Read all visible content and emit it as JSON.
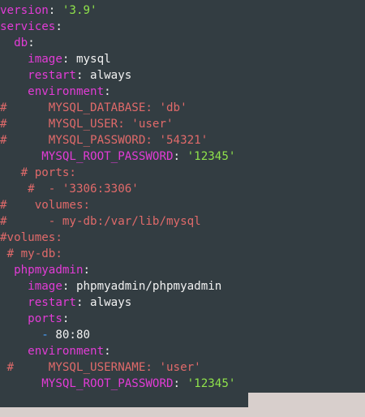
{
  "colors": {
    "background": "#333d42",
    "key": "#e23cd6",
    "string": "#8fe24b",
    "comment": "#e06a6a",
    "plain": "#f2f2f2",
    "dash": "#4aa3ff"
  },
  "lines": [
    [
      {
        "t": "version",
        "c": "key"
      },
      {
        "t": ": ",
        "c": "plain"
      },
      {
        "t": "'3.9'",
        "c": "str"
      }
    ],
    [
      {
        "t": "services",
        "c": "key"
      },
      {
        "t": ":",
        "c": "plain"
      }
    ],
    [
      {
        "t": "  ",
        "c": "plain"
      },
      {
        "t": "db",
        "c": "key"
      },
      {
        "t": ":",
        "c": "plain"
      }
    ],
    [
      {
        "t": "    ",
        "c": "plain"
      },
      {
        "t": "image",
        "c": "key"
      },
      {
        "t": ": mysql",
        "c": "plain"
      }
    ],
    [
      {
        "t": "    ",
        "c": "plain"
      },
      {
        "t": "restart",
        "c": "key"
      },
      {
        "t": ": always",
        "c": "plain"
      }
    ],
    [
      {
        "t": "    ",
        "c": "plain"
      },
      {
        "t": "environment",
        "c": "key"
      },
      {
        "t": ":",
        "c": "plain"
      }
    ],
    [
      {
        "t": "#      MYSQL_DATABASE: 'db'",
        "c": "com"
      }
    ],
    [
      {
        "t": "#      MYSQL_USER: 'user'",
        "c": "com"
      }
    ],
    [
      {
        "t": "#      MYSQL_PASSWORD: '54321'",
        "c": "com"
      }
    ],
    [
      {
        "t": "      ",
        "c": "plain"
      },
      {
        "t": "MYSQL_ROOT_PASSWORD",
        "c": "key"
      },
      {
        "t": ": ",
        "c": "plain"
      },
      {
        "t": "'12345'",
        "c": "str"
      }
    ],
    [
      {
        "t": "   # ports:",
        "c": "com"
      }
    ],
    [
      {
        "t": "    #  - '3306:3306'",
        "c": "com"
      }
    ],
    [
      {
        "t": "#    volumes:",
        "c": "com"
      }
    ],
    [
      {
        "t": "#      - my-db:/var/lib/mysql",
        "c": "com"
      }
    ],
    [
      {
        "t": "#volumes:",
        "c": "com"
      }
    ],
    [
      {
        "t": " # my-db:",
        "c": "com"
      }
    ],
    [
      {
        "t": "  ",
        "c": "plain"
      },
      {
        "t": "phpmyadmin",
        "c": "key"
      },
      {
        "t": ":",
        "c": "plain"
      }
    ],
    [
      {
        "t": "    ",
        "c": "plain"
      },
      {
        "t": "image",
        "c": "key"
      },
      {
        "t": ": phpmyadmin/phpmyadmin",
        "c": "plain"
      }
    ],
    [
      {
        "t": "    ",
        "c": "plain"
      },
      {
        "t": "restart",
        "c": "key"
      },
      {
        "t": ": always",
        "c": "plain"
      }
    ],
    [
      {
        "t": "    ",
        "c": "plain"
      },
      {
        "t": "ports",
        "c": "key"
      },
      {
        "t": ":",
        "c": "plain"
      }
    ],
    [
      {
        "t": "      ",
        "c": "plain"
      },
      {
        "t": "-",
        "c": "dash"
      },
      {
        "t": " 80:80",
        "c": "plain"
      }
    ],
    [
      {
        "t": "    ",
        "c": "plain"
      },
      {
        "t": "environment",
        "c": "key"
      },
      {
        "t": ":",
        "c": "plain"
      }
    ],
    [
      {
        "t": " #     MYSQL_USERNAME: 'user'",
        "c": "com"
      }
    ],
    [
      {
        "t": "      ",
        "c": "plain"
      },
      {
        "t": "MYSQL_ROOT_PASSWORD",
        "c": "key"
      },
      {
        "t": ": ",
        "c": "plain"
      },
      {
        "t": "'12345'",
        "c": "str"
      }
    ]
  ]
}
